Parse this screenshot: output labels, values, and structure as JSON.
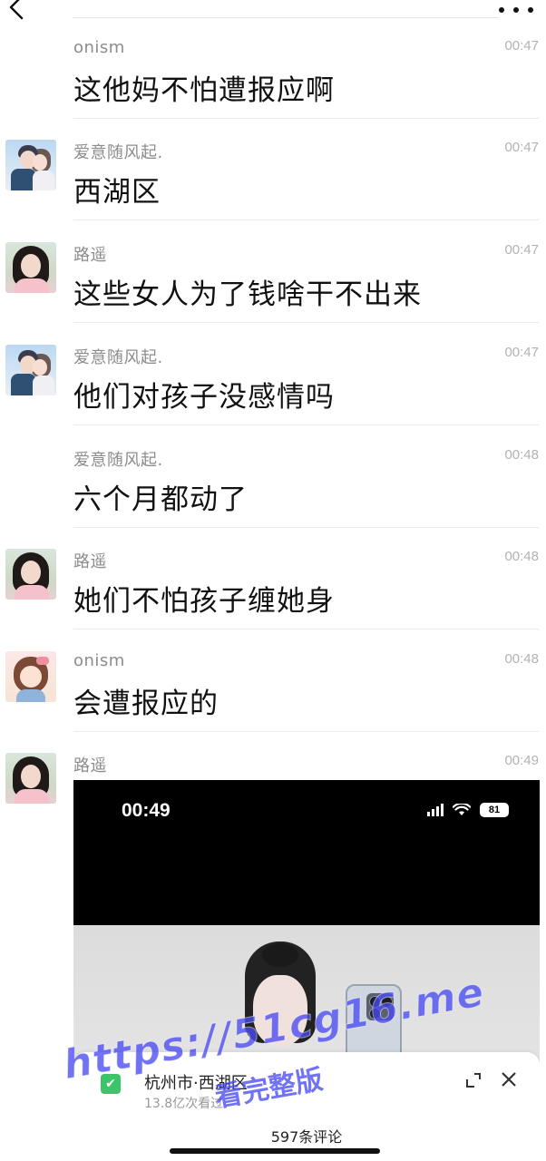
{
  "header": {
    "back_icon": "chevron-left-icon",
    "more_icon": "more-dots-icon"
  },
  "messages": [
    {
      "sender": "onism",
      "time": "00:47",
      "text": "这他妈不怕遭报应啊",
      "avatar": "none"
    },
    {
      "sender": "爱意随风起.",
      "time": "00:47",
      "text": "西湖区",
      "avatar": "couple-avatar"
    },
    {
      "sender": "路遥",
      "time": "00:47",
      "text": "这些女人为了钱啥干不出来",
      "avatar": "girl-avatar"
    },
    {
      "sender": "爱意随风起.",
      "time": "00:47",
      "text": "他们对孩子没感情吗",
      "avatar": "couple-avatar"
    },
    {
      "sender": "爱意随风起.",
      "time": "00:48",
      "text": "六个月都动了",
      "avatar": "none"
    },
    {
      "sender": "路遥",
      "time": "00:48",
      "text": "她们不怕孩子缠她身",
      "avatar": "girl-avatar"
    },
    {
      "sender": "onism",
      "time": "00:48",
      "text": "会遭报应的",
      "avatar": "cartoon-avatar"
    },
    {
      "sender": "路遥",
      "time": "00:49",
      "text": "",
      "avatar": "girl-avatar"
    }
  ],
  "media": {
    "status_time": "00:49",
    "battery": "81",
    "location_title": "杭州市·西湖区",
    "location_sub": "13.8亿次看过",
    "comments_label": "597条评论"
  },
  "watermark": {
    "url": "https://51cg16.me",
    "caption": "看完整版"
  }
}
